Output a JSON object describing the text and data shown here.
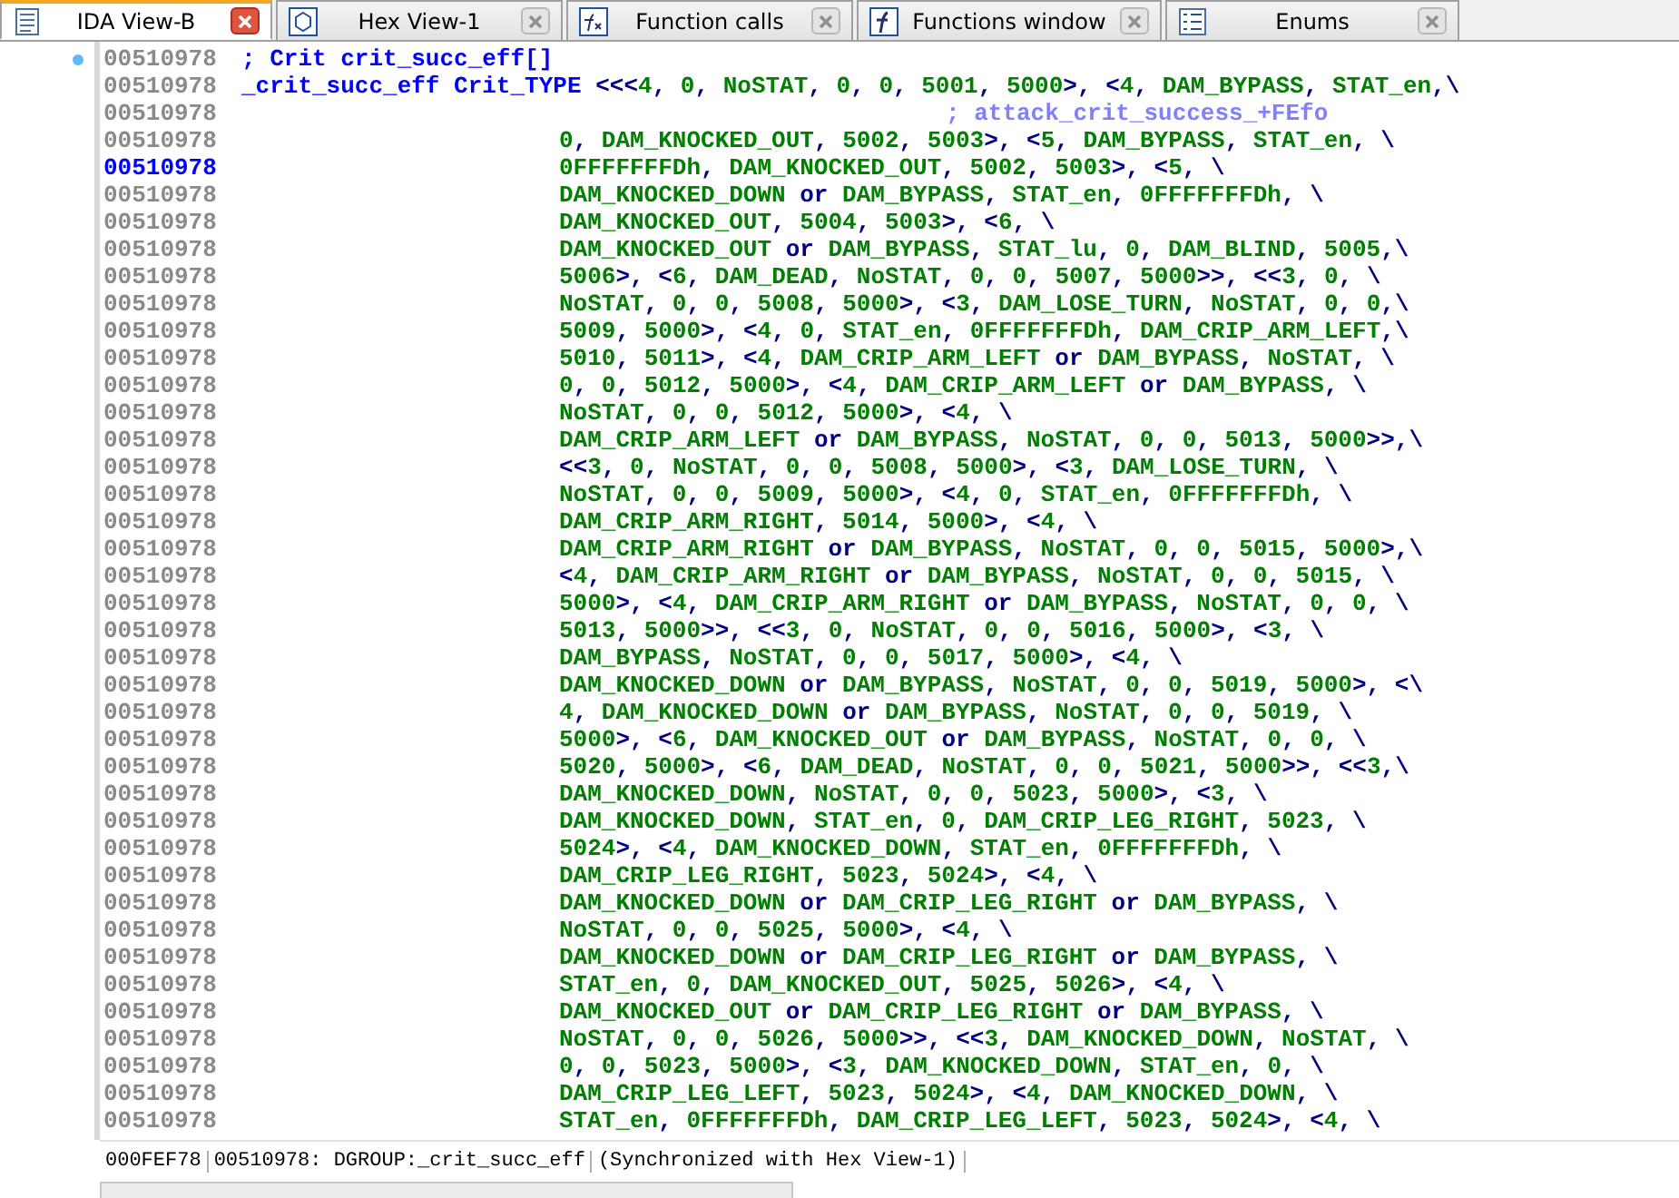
{
  "tabs": [
    {
      "label": "IDA View-B",
      "selected": true
    },
    {
      "label": "Hex View-1",
      "selected": false
    },
    {
      "label": "Function calls",
      "selected": false
    },
    {
      "label": "Functions window",
      "selected": false
    },
    {
      "label": "Enums",
      "selected": false
    }
  ],
  "listing": [
    {
      "address": "00510978",
      "kind": "comment",
      "text": "; Crit crit_succ_eff[]",
      "selected": false,
      "marked": true
    },
    {
      "address": "00510978",
      "kind": "label",
      "name": "_crit_succ_eff",
      "type": "Crit_TYPE",
      "text": "<<<4, 0, NoSTAT, 0, 0, 5001, 5000>, <4, DAM_BYPASS, STAT_en,\\",
      "selected": false,
      "marked": false
    },
    {
      "address": "00510978",
      "kind": "xref",
      "text": "; attack_crit_success_+FEfo",
      "selected": false,
      "marked": false
    },
    {
      "address": "00510978",
      "kind": "data",
      "text": "0, DAM_KNOCKED_OUT, 5002, 5003>, <5, DAM_BYPASS, STAT_en, \\",
      "selected": false,
      "marked": false
    },
    {
      "address": "00510978",
      "kind": "data",
      "text": "0FFFFFFFDh, DAM_KNOCKED_OUT, 5002, 5003>, <5, \\",
      "selected": true,
      "marked": false
    },
    {
      "address": "00510978",
      "kind": "data",
      "text": "DAM_KNOCKED_DOWN or DAM_BYPASS, STAT_en, 0FFFFFFFDh, \\",
      "selected": false,
      "marked": false
    },
    {
      "address": "00510978",
      "kind": "data",
      "text": "DAM_KNOCKED_OUT, 5004, 5003>, <6, \\",
      "selected": false,
      "marked": false
    },
    {
      "address": "00510978",
      "kind": "data",
      "text": "DAM_KNOCKED_OUT or DAM_BYPASS, STAT_lu, 0, DAM_BLIND, 5005,\\",
      "selected": false,
      "marked": false
    },
    {
      "address": "00510978",
      "kind": "data",
      "text": "5006>, <6, DAM_DEAD, NoSTAT, 0, 0, 5007, 5000>>, <<3, 0, \\",
      "selected": false,
      "marked": false
    },
    {
      "address": "00510978",
      "kind": "data",
      "text": "NoSTAT, 0, 0, 5008, 5000>, <3, DAM_LOSE_TURN, NoSTAT, 0, 0,\\",
      "selected": false,
      "marked": false
    },
    {
      "address": "00510978",
      "kind": "data",
      "text": "5009, 5000>, <4, 0, STAT_en, 0FFFFFFFDh, DAM_CRIP_ARM_LEFT,\\",
      "selected": false,
      "marked": false
    },
    {
      "address": "00510978",
      "kind": "data",
      "text": "5010, 5011>, <4, DAM_CRIP_ARM_LEFT or DAM_BYPASS, NoSTAT, \\",
      "selected": false,
      "marked": false
    },
    {
      "address": "00510978",
      "kind": "data",
      "text": "0, 0, 5012, 5000>, <4, DAM_CRIP_ARM_LEFT or DAM_BYPASS, \\",
      "selected": false,
      "marked": false
    },
    {
      "address": "00510978",
      "kind": "data",
      "text": "NoSTAT, 0, 0, 5012, 5000>, <4, \\",
      "selected": false,
      "marked": false
    },
    {
      "address": "00510978",
      "kind": "data",
      "text": "DAM_CRIP_ARM_LEFT or DAM_BYPASS, NoSTAT, 0, 0, 5013, 5000>>,\\",
      "selected": false,
      "marked": false
    },
    {
      "address": "00510978",
      "kind": "data",
      "text": "<<3, 0, NoSTAT, 0, 0, 5008, 5000>, <3, DAM_LOSE_TURN, \\",
      "selected": false,
      "marked": false
    },
    {
      "address": "00510978",
      "kind": "data",
      "text": "NoSTAT, 0, 0, 5009, 5000>, <4, 0, STAT_en, 0FFFFFFFDh, \\",
      "selected": false,
      "marked": false
    },
    {
      "address": "00510978",
      "kind": "data",
      "text": "DAM_CRIP_ARM_RIGHT, 5014, 5000>, <4, \\",
      "selected": false,
      "marked": false
    },
    {
      "address": "00510978",
      "kind": "data",
      "text": "DAM_CRIP_ARM_RIGHT or DAM_BYPASS, NoSTAT, 0, 0, 5015, 5000>,\\",
      "selected": false,
      "marked": false
    },
    {
      "address": "00510978",
      "kind": "data",
      "text": "<4, DAM_CRIP_ARM_RIGHT or DAM_BYPASS, NoSTAT, 0, 0, 5015, \\",
      "selected": false,
      "marked": false
    },
    {
      "address": "00510978",
      "kind": "data",
      "text": "5000>, <4, DAM_CRIP_ARM_RIGHT or DAM_BYPASS, NoSTAT, 0, 0, \\",
      "selected": false,
      "marked": false
    },
    {
      "address": "00510978",
      "kind": "data",
      "text": "5013, 5000>>, <<3, 0, NoSTAT, 0, 0, 5016, 5000>, <3, \\",
      "selected": false,
      "marked": false
    },
    {
      "address": "00510978",
      "kind": "data",
      "text": "DAM_BYPASS, NoSTAT, 0, 0, 5017, 5000>, <4, \\",
      "selected": false,
      "marked": false
    },
    {
      "address": "00510978",
      "kind": "data",
      "text": "DAM_KNOCKED_DOWN or DAM_BYPASS, NoSTAT, 0, 0, 5019, 5000>, <\\",
      "selected": false,
      "marked": false
    },
    {
      "address": "00510978",
      "kind": "data",
      "text": "4, DAM_KNOCKED_DOWN or DAM_BYPASS, NoSTAT, 0, 0, 5019, \\",
      "selected": false,
      "marked": false
    },
    {
      "address": "00510978",
      "kind": "data",
      "text": "5000>, <6, DAM_KNOCKED_OUT or DAM_BYPASS, NoSTAT, 0, 0, \\",
      "selected": false,
      "marked": false
    },
    {
      "address": "00510978",
      "kind": "data",
      "text": "5020, 5000>, <6, DAM_DEAD, NoSTAT, 0, 0, 5021, 5000>>, <<3,\\",
      "selected": false,
      "marked": false
    },
    {
      "address": "00510978",
      "kind": "data",
      "text": "DAM_KNOCKED_DOWN, NoSTAT, 0, 0, 5023, 5000>, <3, \\",
      "selected": false,
      "marked": false
    },
    {
      "address": "00510978",
      "kind": "data",
      "text": "DAM_KNOCKED_DOWN, STAT_en, 0, DAM_CRIP_LEG_RIGHT, 5023, \\",
      "selected": false,
      "marked": false
    },
    {
      "address": "00510978",
      "kind": "data",
      "text": "5024>, <4, DAM_KNOCKED_DOWN, STAT_en, 0FFFFFFFDh, \\",
      "selected": false,
      "marked": false
    },
    {
      "address": "00510978",
      "kind": "data",
      "text": "DAM_CRIP_LEG_RIGHT, 5023, 5024>, <4, \\",
      "selected": false,
      "marked": false
    },
    {
      "address": "00510978",
      "kind": "data",
      "text": "DAM_KNOCKED_DOWN or DAM_CRIP_LEG_RIGHT or DAM_BYPASS, \\",
      "selected": false,
      "marked": false
    },
    {
      "address": "00510978",
      "kind": "data",
      "text": "NoSTAT, 0, 0, 5025, 5000>, <4, \\",
      "selected": false,
      "marked": false
    },
    {
      "address": "00510978",
      "kind": "data",
      "text": "DAM_KNOCKED_DOWN or DAM_CRIP_LEG_RIGHT or DAM_BYPASS, \\",
      "selected": false,
      "marked": false
    },
    {
      "address": "00510978",
      "kind": "data",
      "text": "STAT_en, 0, DAM_KNOCKED_OUT, 5025, 5026>, <4, \\",
      "selected": false,
      "marked": false
    },
    {
      "address": "00510978",
      "kind": "data",
      "text": "DAM_KNOCKED_OUT or DAM_CRIP_LEG_RIGHT or DAM_BYPASS, \\",
      "selected": false,
      "marked": false
    },
    {
      "address": "00510978",
      "kind": "data",
      "text": "NoSTAT, 0, 0, 5026, 5000>>, <<3, DAM_KNOCKED_DOWN, NoSTAT, \\",
      "selected": false,
      "marked": false
    },
    {
      "address": "00510978",
      "kind": "data",
      "text": "0, 0, 5023, 5000>, <3, DAM_KNOCKED_DOWN, STAT_en, 0, \\",
      "selected": false,
      "marked": false
    },
    {
      "address": "00510978",
      "kind": "data",
      "text": "DAM_CRIP_LEG_LEFT, 5023, 5024>, <4, DAM_KNOCKED_DOWN, \\",
      "selected": false,
      "marked": false
    },
    {
      "address": "00510978",
      "kind": "data",
      "text": "STAT_en, 0FFFFFFFDh, DAM_CRIP_LEG_LEFT, 5023, 5024>, <4, \\",
      "selected": false,
      "marked": false
    }
  ],
  "status_bar": {
    "offset": "000FEF78",
    "location": "00510978: DGROUP:_crit_succ_eff",
    "sync": "(Synchronized with Hex View-1)"
  }
}
